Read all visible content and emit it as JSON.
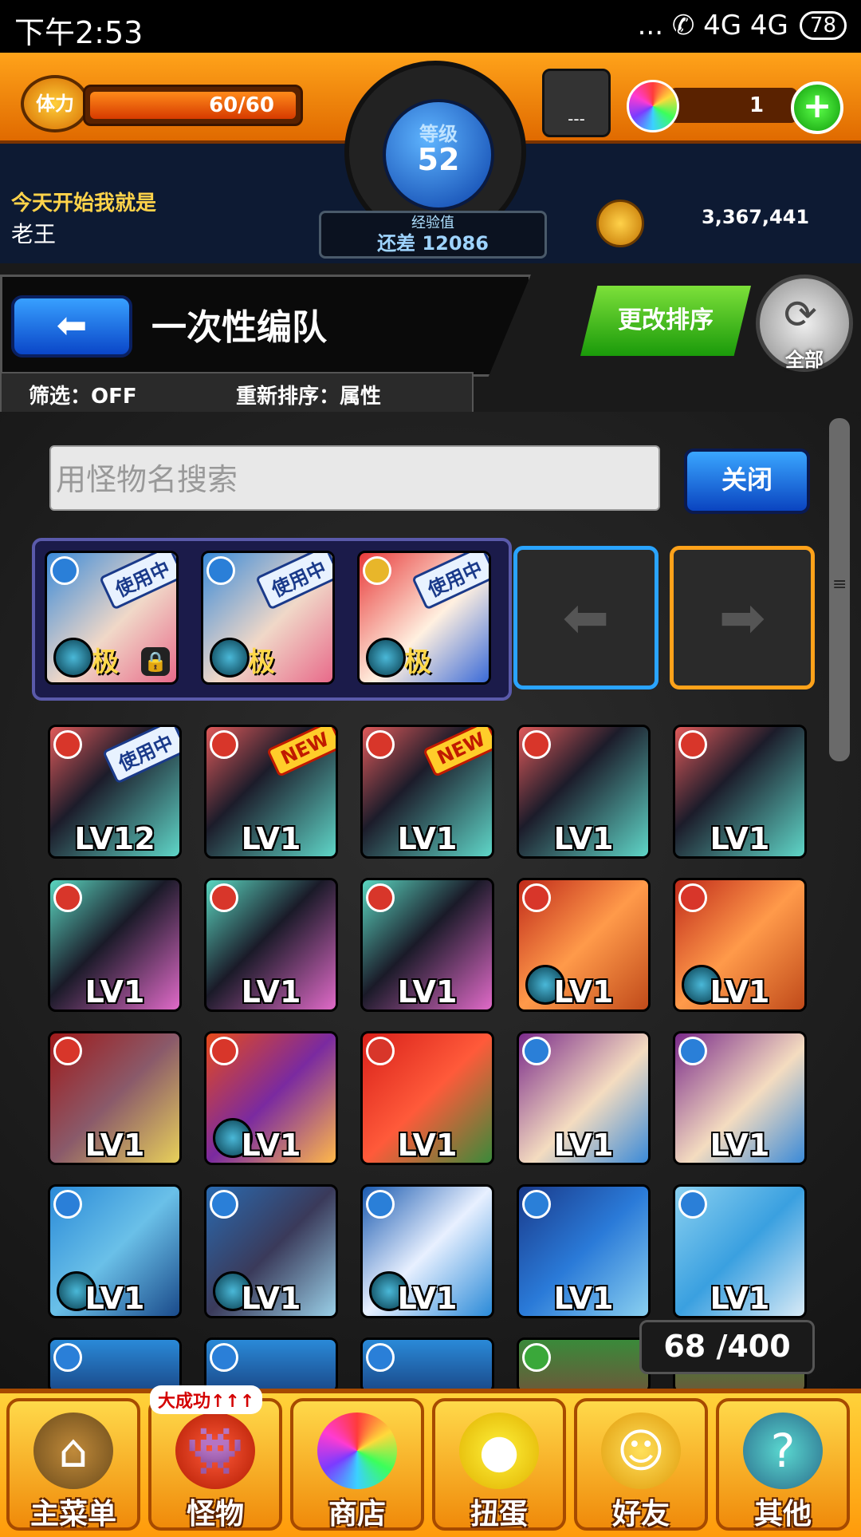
{
  "status_bar": {
    "time": "下午2:53",
    "indicators": "... ✆ 4G 4G",
    "battery": "78"
  },
  "header": {
    "stamina_label": "体力",
    "stamina_value": "60/60",
    "stamina_fraction": 1.0,
    "level_label": "等级",
    "level_value": "52",
    "exp_label": "经验值",
    "exp_remaining": "还差 12086",
    "trophy_value": "---",
    "orb_count": "1",
    "player_title": "今天开始我就是",
    "player_name": "老王",
    "coins": "3,367,441"
  },
  "titlebar": {
    "back_icon": "back-arrow-icon",
    "title": "一次性编队",
    "filter": "筛选：OFF",
    "sort": "重新排序：属性",
    "reorder_button": "更改排序",
    "all_button": "全部"
  },
  "search": {
    "placeholder": "用怪物名搜索",
    "close_button": "关闭"
  },
  "team": [
    {
      "attr": "water",
      "badge": "使用中",
      "ji": "极",
      "locked": true
    },
    {
      "attr": "water",
      "badge": "使用中",
      "ji": "极",
      "locked": false
    },
    {
      "attr": "light",
      "badge": "使用中",
      "ji": "极",
      "locked": false
    }
  ],
  "monster_grid": [
    [
      {
        "attr": "fire",
        "level": "LV12",
        "badge": "使用中",
        "art": "black-dragon"
      },
      {
        "attr": "fire",
        "level": "LV1",
        "badge": "NEW",
        "art": "black-dragon"
      },
      {
        "attr": "fire",
        "level": "LV1",
        "badge": "NEW",
        "art": "black-dragon"
      },
      {
        "attr": "fire",
        "level": "LV1",
        "art": "black-dragon"
      },
      {
        "attr": "fire",
        "level": "LV1",
        "art": "black-dragon"
      }
    ],
    [
      {
        "attr": "fire",
        "level": "LV1",
        "art": "dark-dragon"
      },
      {
        "attr": "fire",
        "level": "LV1",
        "art": "dark-dragon"
      },
      {
        "attr": "fire",
        "level": "LV1",
        "art": "dark-dragon"
      },
      {
        "attr": "fire",
        "level": "LV1",
        "gem": true,
        "art": "girl-drum"
      },
      {
        "attr": "fire",
        "level": "LV1",
        "gem": true,
        "art": "girl-drum"
      }
    ],
    [
      {
        "attr": "fire",
        "level": "LV1",
        "art": "ogre"
      },
      {
        "attr": "fire",
        "level": "LV1",
        "gem": true,
        "art": "fire-demon"
      },
      {
        "attr": "fire",
        "level": "LV1",
        "art": "red-oni"
      },
      {
        "attr": "water",
        "level": "LV1",
        "art": "purple-girl"
      },
      {
        "attr": "water",
        "level": "LV1",
        "art": "purple-girl"
      }
    ],
    [
      {
        "attr": "water",
        "level": "LV1",
        "gem": true,
        "art": "blue-beast"
      },
      {
        "attr": "water",
        "level": "LV1",
        "gem": true,
        "art": "ninja-girl"
      },
      {
        "attr": "water",
        "level": "LV1",
        "gem": true,
        "art": "blue-swordsman"
      },
      {
        "attr": "water",
        "level": "LV1",
        "art": "water-dragon"
      },
      {
        "attr": "water",
        "level": "LV1",
        "art": "blue-bird"
      }
    ],
    [
      {
        "attr": "water",
        "art": "blue-partial"
      },
      {
        "attr": "water",
        "art": "blue-partial"
      },
      {
        "attr": "water",
        "art": "blue-partial"
      },
      {
        "attr": "wood",
        "art": "green-partial"
      },
      {
        "attr": "wood",
        "art": "green-partial"
      }
    ]
  ],
  "box_count": "68 /400",
  "nav": [
    {
      "label": "主菜单",
      "icon": "castle-gate-icon"
    },
    {
      "label": "怪物",
      "icon": "red-monster-icon",
      "badge": "大成功↑↑↑"
    },
    {
      "label": "商店",
      "icon": "rainbow-orb-icon"
    },
    {
      "label": "扭蛋",
      "icon": "egg-icon"
    },
    {
      "label": "好友",
      "icon": "friends-icon"
    },
    {
      "label": "其他",
      "icon": "question-diamond-icon"
    }
  ],
  "colors": {
    "fire": "#d8362a",
    "water": "#2a7fd8",
    "light": "#e8b62a",
    "wood": "#3aa83a",
    "accent_orange": "#ff9a0a"
  }
}
